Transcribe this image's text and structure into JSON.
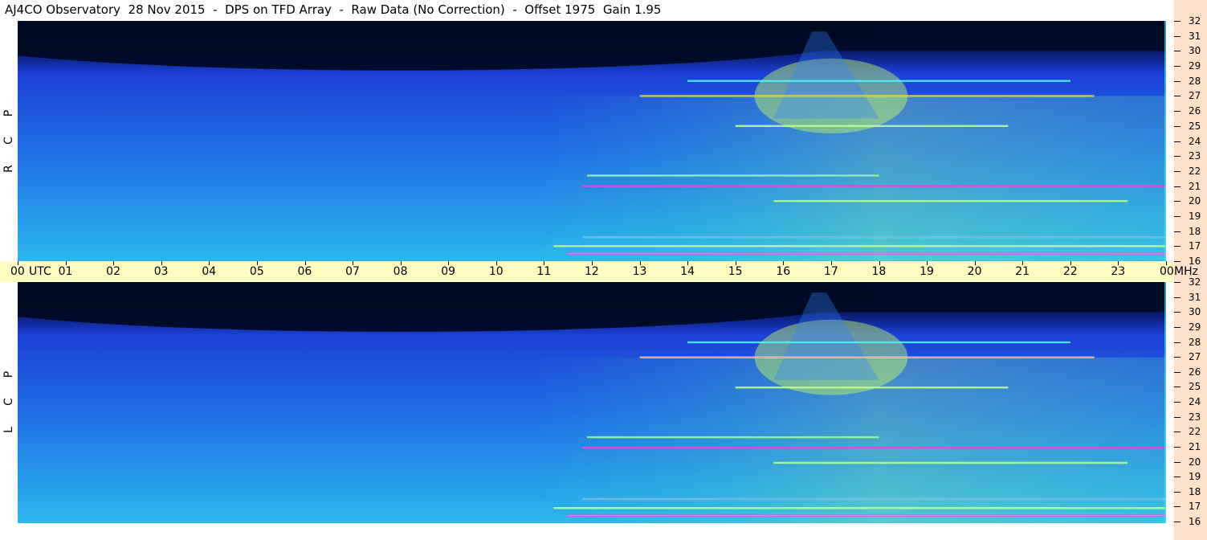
{
  "title": "AJ4CO Observatory  28 Nov 2015  -  DPS on TFD Array  -  Raw Data (No Correction)  -  Offset 1975  Gain 1.95",
  "panels": [
    {
      "label_letters": [
        "R",
        "C",
        "P"
      ]
    },
    {
      "label_letters": [
        "L",
        "C",
        "P"
      ]
    }
  ],
  "time_axis": {
    "utc_label": "UTC",
    "unit_label": "MHz",
    "hours": [
      "00",
      "01",
      "02",
      "03",
      "04",
      "05",
      "06",
      "07",
      "08",
      "09",
      "10",
      "11",
      "12",
      "13",
      "14",
      "15",
      "16",
      "17",
      "18",
      "19",
      "20",
      "21",
      "22",
      "23",
      "00"
    ]
  },
  "chart_data": {
    "type": "heatmap",
    "title": "AJ4CO Observatory  28 Nov 2015  -  DPS on TFD Array  -  Raw Data (No Correction)  -  Offset 1975  Gain 1.95",
    "x_axis": {
      "label": "UTC",
      "range": [
        0,
        24
      ],
      "unit": "hours",
      "ticks": [
        "00",
        "01",
        "02",
        "03",
        "04",
        "05",
        "06",
        "07",
        "08",
        "09",
        "10",
        "11",
        "12",
        "13",
        "14",
        "15",
        "16",
        "17",
        "18",
        "19",
        "20",
        "21",
        "22",
        "23",
        "00"
      ]
    },
    "y_axis": {
      "label": "MHz",
      "range": [
        16,
        32
      ],
      "ticks": [
        16,
        17,
        18,
        19,
        20,
        21,
        22,
        23,
        24,
        25,
        26,
        27,
        28,
        29,
        30,
        31,
        32
      ]
    },
    "panels": [
      "RCP",
      "LCP"
    ],
    "colors": {
      "background_low": "#000822",
      "mid": "#1b4fe0",
      "high": "#2dbde8",
      "rfi_hot": "#f0ff40",
      "rfi_peak": "#e020d0"
    },
    "features": [
      {
        "kind": "dark_band",
        "freq_range": [
          30,
          32
        ],
        "time_range": [
          0,
          24
        ]
      },
      {
        "kind": "solar_brightening",
        "time_range": [
          11,
          24
        ]
      },
      {
        "kind": "rfi_line",
        "freq": 27,
        "time_range": [
          13,
          22.5
        ]
      },
      {
        "kind": "rfi_line",
        "freq": 28,
        "time_range": [
          14,
          22
        ]
      },
      {
        "kind": "rfi_line",
        "freq": 25,
        "time_range": [
          15,
          20.7
        ]
      },
      {
        "kind": "rfi_line",
        "freq": 21,
        "time_range": [
          11.8,
          24
        ]
      },
      {
        "kind": "rfi_line",
        "freq": 21.7,
        "time_range": [
          11.9,
          18
        ]
      },
      {
        "kind": "rfi_line",
        "freq": 20,
        "time_range": [
          15.8,
          23.2
        ]
      },
      {
        "kind": "rfi_line",
        "freq": 17.6,
        "time_range": [
          11.8,
          24
        ]
      },
      {
        "kind": "rfi_line",
        "freq": 17,
        "time_range": [
          11.2,
          24
        ]
      },
      {
        "kind": "rfi_line",
        "freq": 16.5,
        "time_range": [
          11.5,
          24
        ]
      }
    ]
  }
}
